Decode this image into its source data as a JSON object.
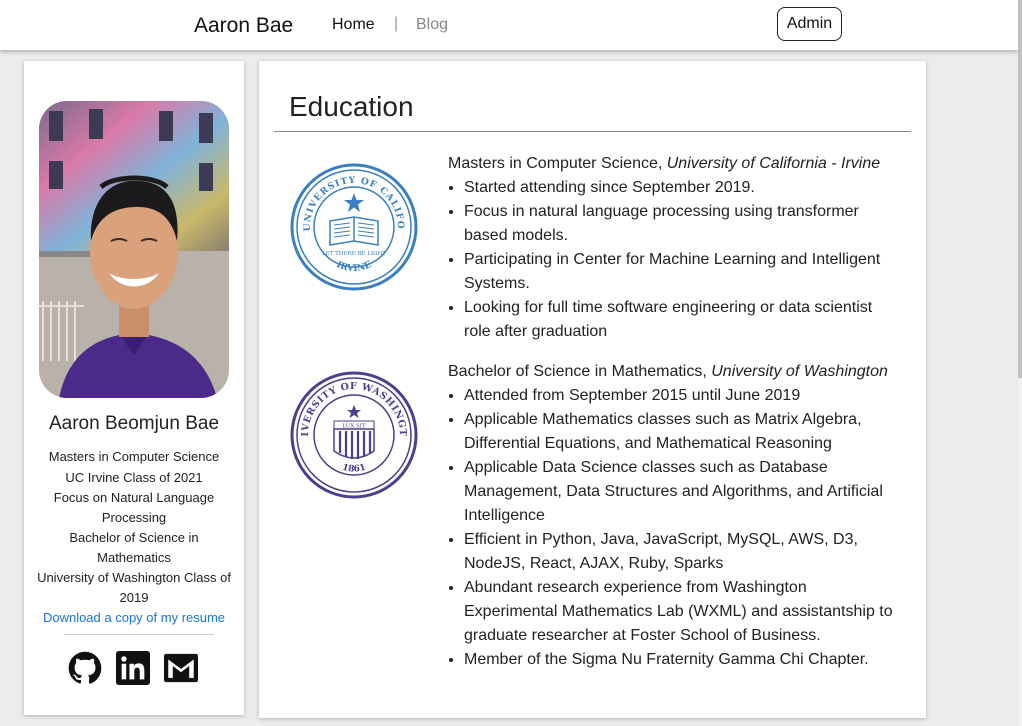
{
  "nav": {
    "brand": "Aaron Bae",
    "home": "Home",
    "separator": "|",
    "blog": "Blog",
    "admin": "Admin"
  },
  "profile": {
    "name": "Aaron Beomjun Bae",
    "lines": [
      "Masters in Computer Science",
      "UC Irvine Class of 2021",
      "Focus on Natural Language Processing",
      "Bachelor of Science in Mathematics",
      "University of Washington Class of 2019"
    ],
    "resume_link": "Download a copy of my resume",
    "social_icons": [
      "github-icon",
      "linkedin-icon",
      "gmail-icon"
    ]
  },
  "education": {
    "title": "Education",
    "entries": [
      {
        "degree": "Masters in Computer Science, ",
        "school": "University of California - Irvine",
        "seal_text_top": "THE UNIVERSITY OF CALIFORNIA",
        "seal_text_bottom": "IRVINE",
        "seal_banner": "LET THERE BE LIGHT",
        "bullets": [
          "Started attending since September 2019.",
          "Focus in natural language processing using transformer based models.",
          "Participating in Center for Machine Learning and Intelligent Systems.",
          "Looking for full time software engineering or data scientist role after graduation"
        ]
      },
      {
        "degree": "Bachelor of Science in Mathematics, ",
        "school": "University of Washington",
        "seal_text_top": "UNIVERSITY OF WASHINGTON",
        "seal_text_bottom": "1861",
        "seal_banner": "LUX SIT",
        "bullets": [
          "Attended from September 2015 until June 2019",
          "Applicable Mathematics classes such as Matrix Algebra, Differential Equations, and Mathematical Reasoning",
          "Applicable Data Science classes such as Database Management, Data Structures and Algorithms, and Artificial Intelligence",
          "Efficient in Python, Java, JavaScript, MySQL, AWS, D3, NodeJS, React, AJAX, Ruby, Sparks",
          "Abundant research experience from Washington Experimental Mathematics Lab (WXML) and assistantship to graduate researcher at Foster School of Business.",
          "Member of the Sigma Nu Fraternity Gamma Chi Chapter."
        ]
      }
    ]
  },
  "colors": {
    "link": "#1a73e8",
    "uci_blue": "#3a7fc0",
    "uw_purple": "#4b3f8f",
    "shirt_purple": "#4b2a8a"
  }
}
